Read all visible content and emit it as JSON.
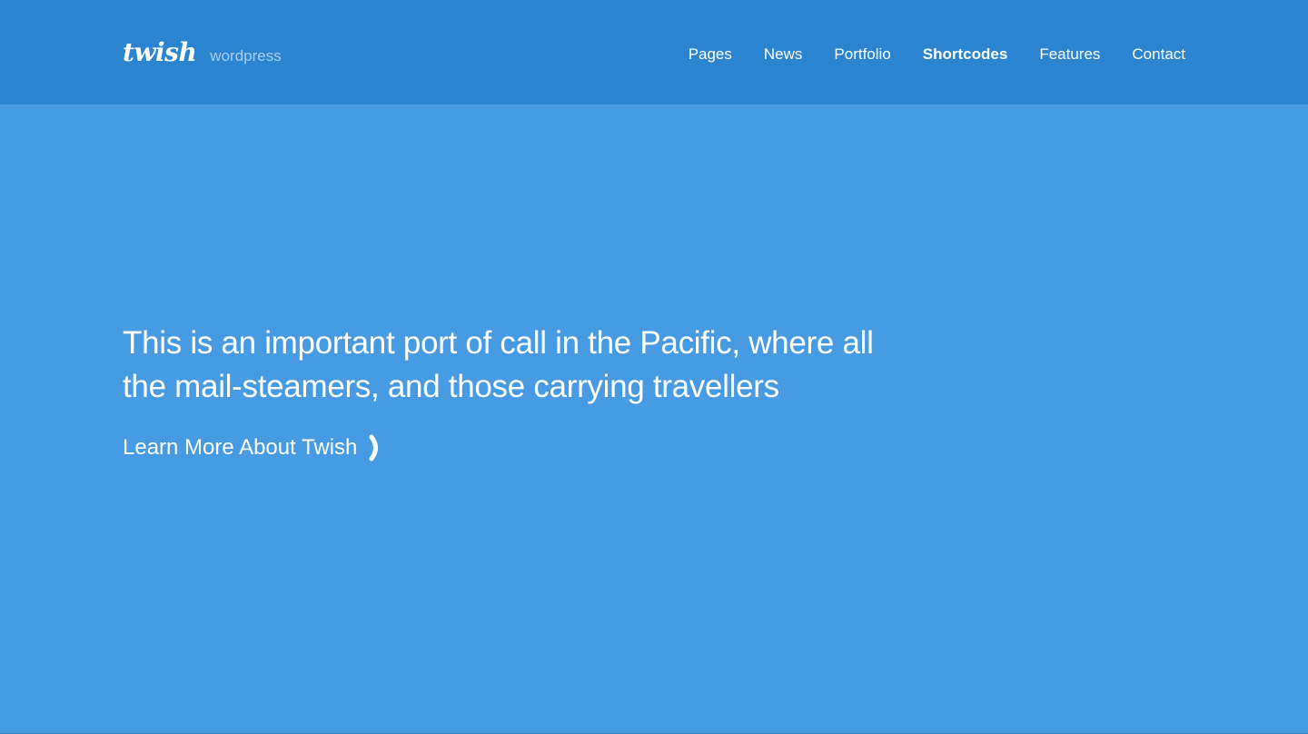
{
  "header": {
    "logo": "twish",
    "tagline": "wordpress",
    "nav": [
      {
        "label": "Pages",
        "active": false
      },
      {
        "label": "News",
        "active": false
      },
      {
        "label": "Portfolio",
        "active": false
      },
      {
        "label": "Shortcodes",
        "active": true
      },
      {
        "label": "Features",
        "active": false
      },
      {
        "label": "Contact",
        "active": false
      }
    ]
  },
  "hero": {
    "text": "This is an important port of call in the Pacific, where all the mail-steamers, and those carrying travellers",
    "cta_label": "Learn More About Twish",
    "cta_icon": "chevron-right-icon"
  },
  "colors": {
    "header_bg": "#2a84d0",
    "hero_bg": "#469be3",
    "text": "#ffffff",
    "tagline": "#a9cff1"
  }
}
